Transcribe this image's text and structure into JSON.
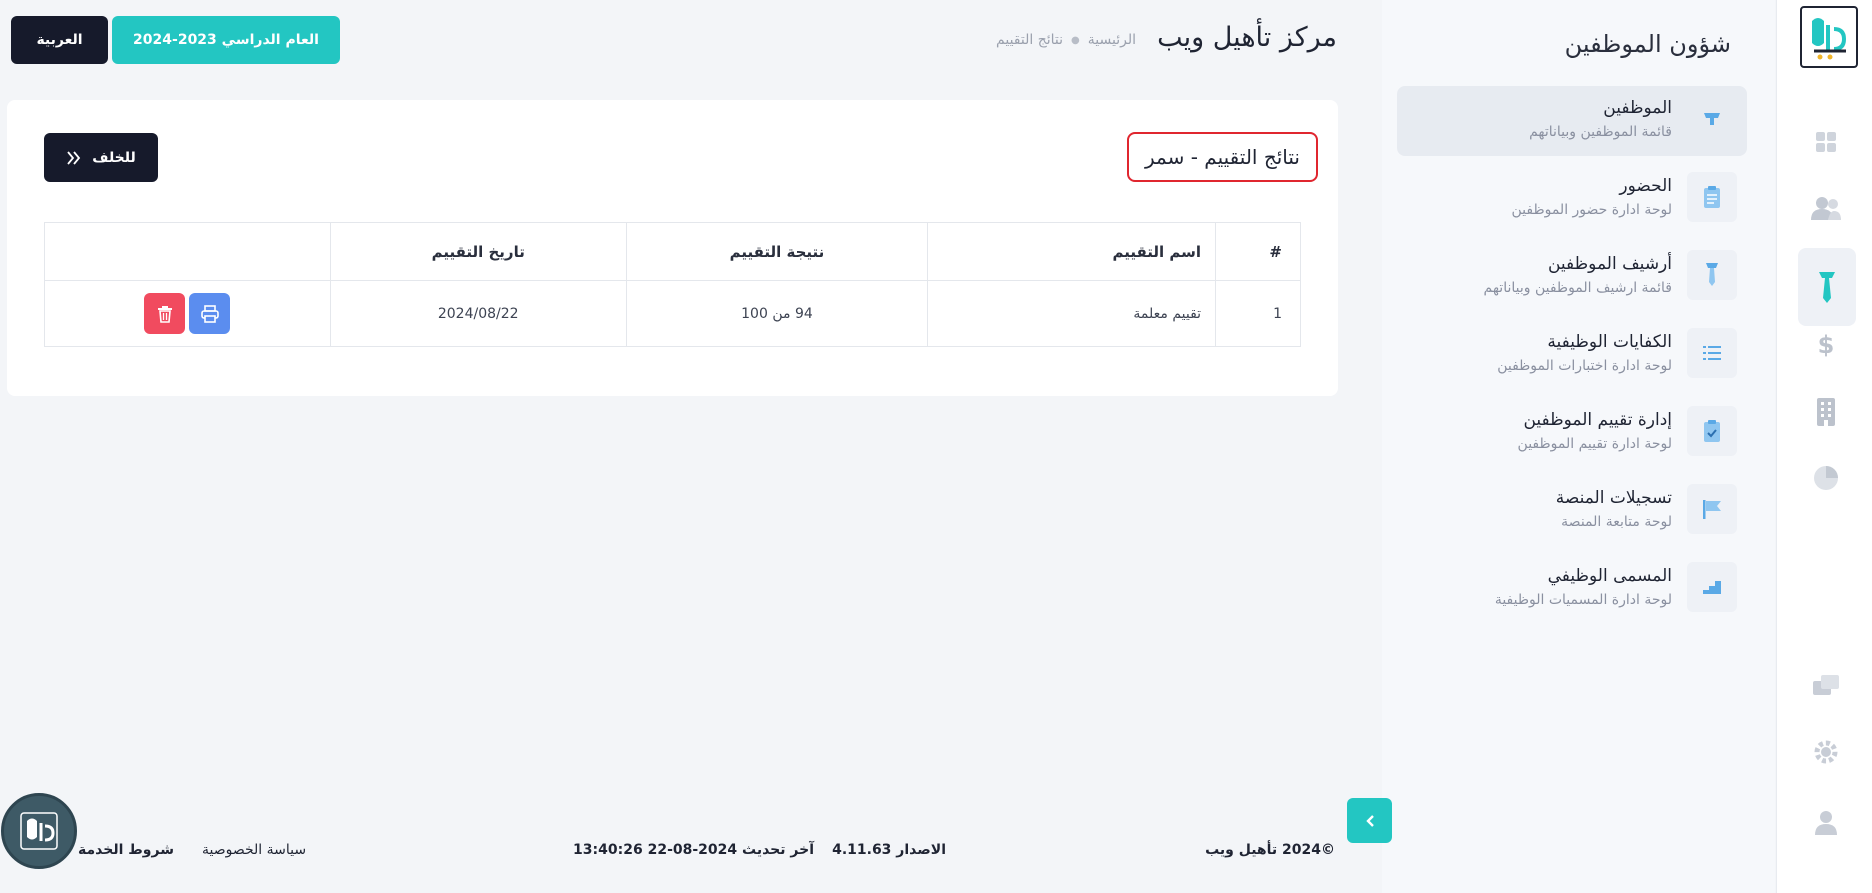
{
  "header": {
    "site_title": "مركز تأهيل ويب",
    "breadcrumb_home": "الرئيسية",
    "breadcrumb_current": "نتائج التقييم",
    "year_label": "العام الدراسي 2023-2024",
    "language_label": "العربية"
  },
  "sidebar": {
    "title": "شؤون الموظفين",
    "items": [
      {
        "title": "الموظفين",
        "subtitle": "قائمة الموظفين وبياناتهم",
        "icon": "tie-icon",
        "active": true
      },
      {
        "title": "الحضور",
        "subtitle": "لوحة ادارة حضور الموظفين",
        "icon": "clipboard-icon"
      },
      {
        "title": "أرشيف الموظفين",
        "subtitle": "قائمة ارشيف الموظفين وبياناتهم",
        "icon": "tie-icon"
      },
      {
        "title": "الكفايات الوظيفية",
        "subtitle": "لوحة ادارة اختبارات الموظفين",
        "icon": "list-icon"
      },
      {
        "title": "إدارة تقييم الموظفين",
        "subtitle": "لوحة ادارة تقييم الموظفين",
        "icon": "clipboard-check-icon"
      },
      {
        "title": "تسجيلات المنصة",
        "subtitle": "لوحة متابعة المنصة",
        "icon": "flag-icon"
      },
      {
        "title": "المسمى الوظيفي",
        "subtitle": "لوحة ادارة المسميات الوظيفية",
        "icon": "stairs-icon"
      }
    ]
  },
  "card": {
    "title": "نتائج التقييم - سمر",
    "back_label": "للخلف",
    "table": {
      "headers": [
        "#",
        "اسم التقييم",
        "نتيجة التقييم",
        "تاريخ التقييم",
        ""
      ],
      "rows": [
        {
          "num": "1",
          "name": "تقييم معلمة",
          "result": "94 من 100",
          "date": "2024/08/22"
        }
      ]
    }
  },
  "footer": {
    "copyright": "©2024  تأهيل ويب",
    "version": "الاصدار 4.11.63",
    "last_update": "آخر تحديث 2024-08-22 13:40:26",
    "privacy": "سياسة الخصوصية",
    "terms": "شروط الخدمة"
  },
  "colors": {
    "accent": "#23c6c2",
    "dark": "#161a2b",
    "danger": "#f14b5f",
    "primary": "#5b8def",
    "highlight_border": "#e0262f"
  }
}
